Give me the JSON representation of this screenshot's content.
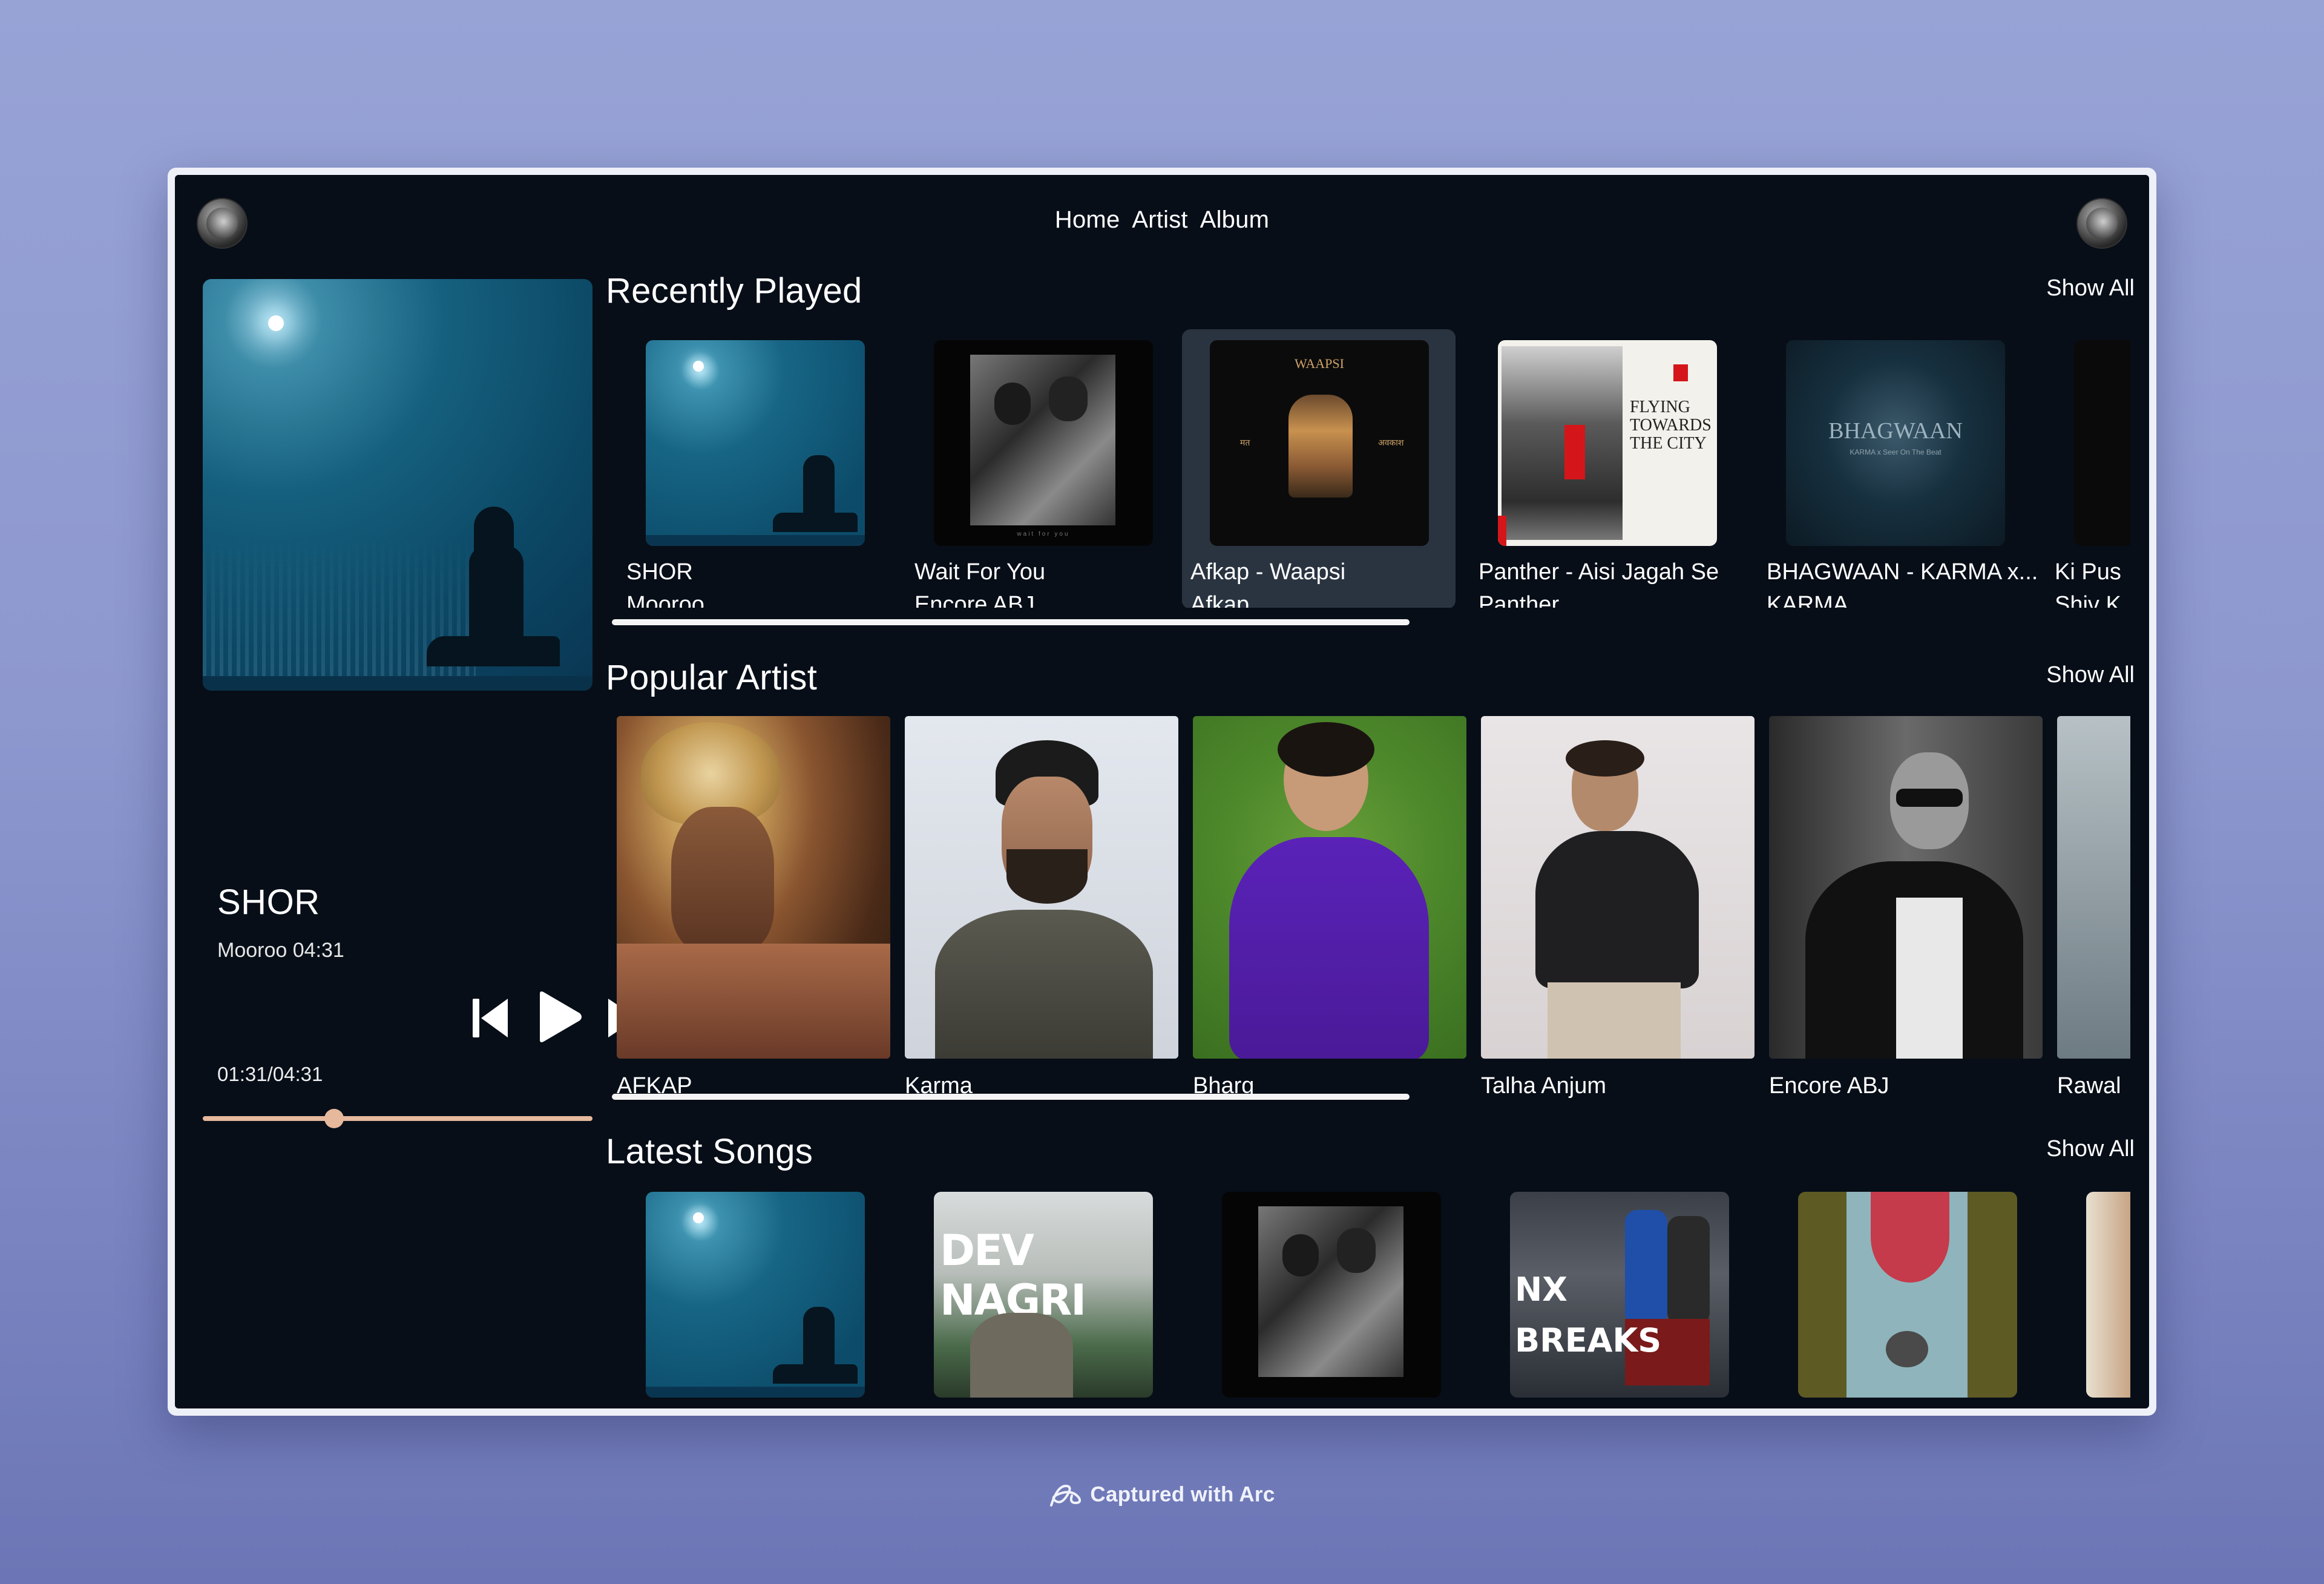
{
  "nav": {
    "items": [
      "Home",
      "Artist",
      "Album"
    ]
  },
  "player": {
    "title": "SHOR",
    "subtitle": "Mooroo 04:31",
    "time": "01:31/04:31",
    "progress": 0.337
  },
  "recently_played": {
    "title": "Recently Played",
    "show_all": "Show All",
    "items": [
      {
        "title": "SHOR",
        "artist": "Mooroo"
      },
      {
        "title": "Wait For You",
        "artist": "Encore ABJ"
      },
      {
        "title": "Afkap - Waapsi",
        "artist": "Afkap"
      },
      {
        "title": "Panther - Aisi Jagah Se",
        "artist": "Panther"
      },
      {
        "title": "BHAGWAAN - KARMA x...",
        "artist": "KARMA"
      },
      {
        "title": "Ki Pus",
        "artist": "Shiv K"
      }
    ]
  },
  "popular_artist": {
    "title": "Popular Artist",
    "show_all": "Show All",
    "items": [
      "AFKAP",
      "Karma",
      "Bharg",
      "Talha Anjum",
      "Encore ABJ",
      "Rawal"
    ]
  },
  "latest_songs": {
    "title": "Latest Songs",
    "show_all": "Show All",
    "cover_texts": [
      "DEV NAGRI",
      "NX BREAKS"
    ]
  },
  "art_texts": {
    "waapsi": "WAAPSI",
    "waapsi_left": "मत",
    "waapsi_right": "अवकाश",
    "wait_for_you": "wait for you",
    "flying": "FLYING TOWARDS THE CITY",
    "bhagwaan": "BHAGWAAN",
    "bhagwaan_sub": "KARMA x Seer On The Beat"
  },
  "caption": "Captured with Arc",
  "colors": {
    "accent": "#e6b89c",
    "app_bg": "#070e18",
    "active_card": "#2a3441"
  }
}
